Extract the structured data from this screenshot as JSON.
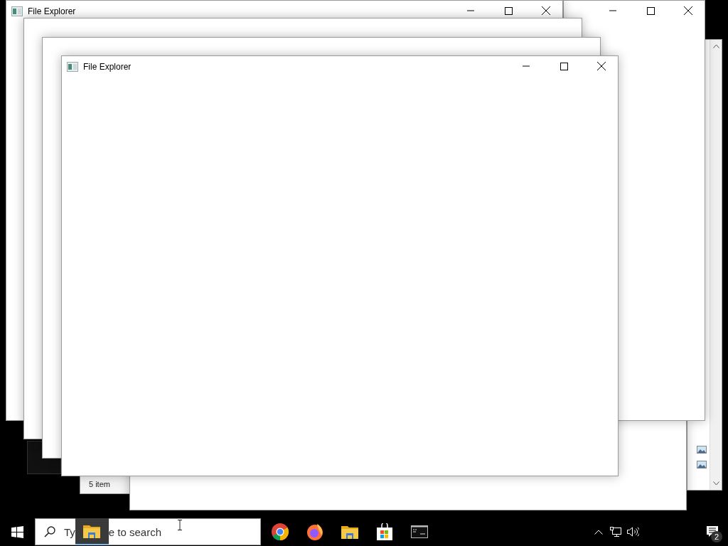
{
  "windows": [
    {
      "kind": "scrollpane"
    },
    {
      "kind": "status",
      "status_text": "5 item"
    },
    {
      "kind": "blank"
    },
    {
      "kind": "controls"
    },
    {
      "kind": "titled",
      "title": "File Explorer"
    },
    {
      "kind": "dark"
    },
    {
      "kind": "blank"
    },
    {
      "kind": "blank"
    },
    {
      "kind": "titled",
      "title": "File Explorer"
    }
  ],
  "taskbar": {
    "search_before": "Ty",
    "search_after": "e to search",
    "notification_count": "2"
  }
}
